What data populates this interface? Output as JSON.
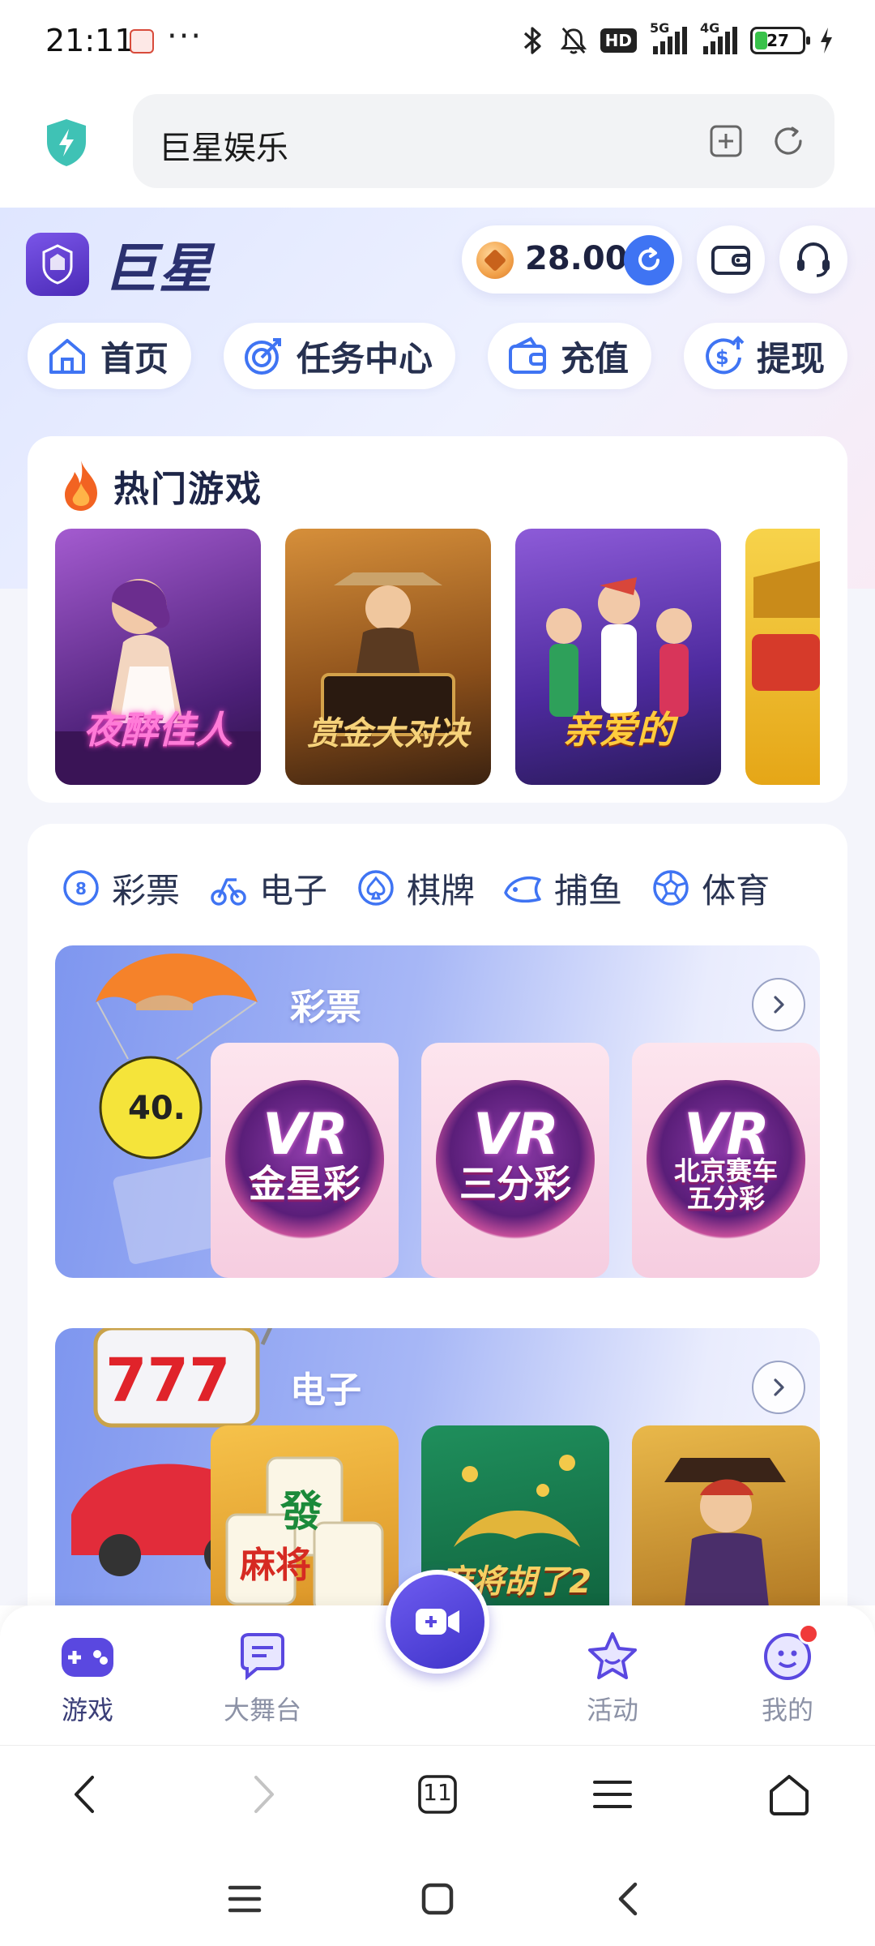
{
  "status_bar": {
    "time": "21:11",
    "more": "···",
    "battery_level": "27",
    "battery_fraction": 0.27,
    "network_1": "5G",
    "network_2": "4G",
    "hd_label": "HD",
    "icons": [
      "bluetooth-icon",
      "mute-icon",
      "hd-voice-icon",
      "signal-5g-icon",
      "signal-4g-icon",
      "battery-icon",
      "charging-icon"
    ]
  },
  "browser": {
    "url_text": "巨星娱乐",
    "tab_count": "11",
    "icons": [
      "shield-icon",
      "add-bookmark-icon",
      "reload-icon",
      "back-icon",
      "forward-icon",
      "tabs-icon",
      "menu-icon",
      "home-icon"
    ]
  },
  "header": {
    "brand_name": "巨星",
    "balance": "28.00"
  },
  "quick_nav": [
    {
      "label": "首页",
      "icon": "home-icon"
    },
    {
      "label": "任务中心",
      "icon": "target-icon"
    },
    {
      "label": "充值",
      "icon": "wallet-icon"
    },
    {
      "label": "提现",
      "icon": "withdraw-icon"
    }
  ],
  "hot_games": {
    "title": "热门游戏",
    "items": [
      {
        "name": "夜醉佳人",
        "color": "#7b3fa6"
      },
      {
        "name": "赏金大对决",
        "color": "#8a5a23"
      },
      {
        "name": "亲爱的",
        "color": "#5a3aa8"
      },
      {
        "name": "",
        "color": "#e3b628"
      }
    ]
  },
  "categories": [
    {
      "label": "彩票",
      "icon": "lottery-icon"
    },
    {
      "label": "电子",
      "icon": "slots-icon"
    },
    {
      "label": "棋牌",
      "icon": "cards-icon"
    },
    {
      "label": "捕鱼",
      "icon": "fish-icon"
    },
    {
      "label": "体育",
      "icon": "football-icon"
    }
  ],
  "sections": [
    {
      "title": "彩票",
      "tiles": [
        {
          "logo": "VR",
          "name": "金星彩"
        },
        {
          "logo": "VR",
          "name": "三分彩"
        },
        {
          "logo": "VR",
          "name": "北京赛车五分彩"
        }
      ],
      "deco_ball": "40."
    },
    {
      "title": "电子",
      "tiles": [
        {
          "name": "麻将",
          "color": "#e29a2a"
        },
        {
          "name": "麻将胡了2",
          "color": "#127a4a"
        },
        {
          "name": "",
          "color": "#d8a43a"
        }
      ],
      "deco_slot": "777"
    }
  ],
  "app_tabs": [
    {
      "label": "游戏",
      "icon": "gamepad-icon",
      "active": true
    },
    {
      "label": "大舞台",
      "icon": "chat-icon",
      "active": false
    },
    {
      "label": "",
      "icon": "live-camera-icon",
      "active": false
    },
    {
      "label": "活动",
      "icon": "star-icon",
      "active": false
    },
    {
      "label": "我的",
      "icon": "profile-icon",
      "active": false
    }
  ],
  "colors": {
    "accent": "#3f74f3",
    "brand": "#2b3170",
    "live_button": "#5a48e0",
    "notification": "#f03a3a"
  }
}
